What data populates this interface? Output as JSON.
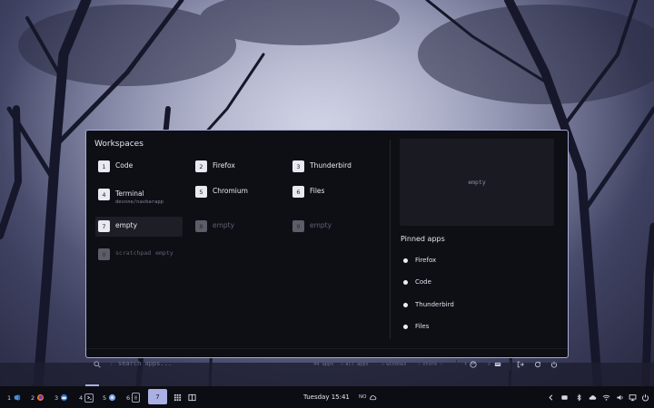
{
  "workspaces": {
    "title": "Workspaces",
    "items": [
      {
        "num": "1",
        "name": "Code",
        "sub": ""
      },
      {
        "num": "2",
        "name": "Firefox",
        "sub": ""
      },
      {
        "num": "3",
        "name": "Thunderbird",
        "sub": ""
      },
      {
        "num": "4",
        "name": "Terminal",
        "sub": "devone/navbarapp"
      },
      {
        "num": "5",
        "name": "Chromium",
        "sub": ""
      },
      {
        "num": "6",
        "name": "Files",
        "sub": ""
      },
      {
        "num": "7",
        "name": "empty",
        "sub": ""
      },
      {
        "num": "8",
        "name": "empty",
        "sub": ""
      },
      {
        "num": "9",
        "name": "empty",
        "sub": ""
      }
    ],
    "scratchpad": {
      "num": "0",
      "name": "scratchpad",
      "extra": "empty"
    }
  },
  "preview": {
    "label": "empty"
  },
  "pinned": {
    "title": "Pinned apps",
    "items": [
      "Firefox",
      "Code",
      "Thunderbird",
      "Files"
    ]
  },
  "search": {
    "key": "/",
    "placeholder": "search apps...",
    "apps_count": "44 apps",
    "all_apps": {
      "key": "a",
      "label": "all apps"
    },
    "windows": {
      "key": "w",
      "label": "windows"
    },
    "store": {
      "key": "s",
      "label": "store"
    },
    "tool_keys": {
      "theme": "t",
      "clip": "c"
    }
  },
  "taskbar": {
    "workspaces": [
      "1",
      "2",
      "3",
      "4",
      "5",
      "6"
    ],
    "active": "7",
    "clock": "Tuesday 15:41",
    "lang": "NO"
  },
  "colors": {
    "accent": "#aab0e4",
    "panel_bg": "#0e0f15",
    "panel_border": "#a7abd6"
  }
}
